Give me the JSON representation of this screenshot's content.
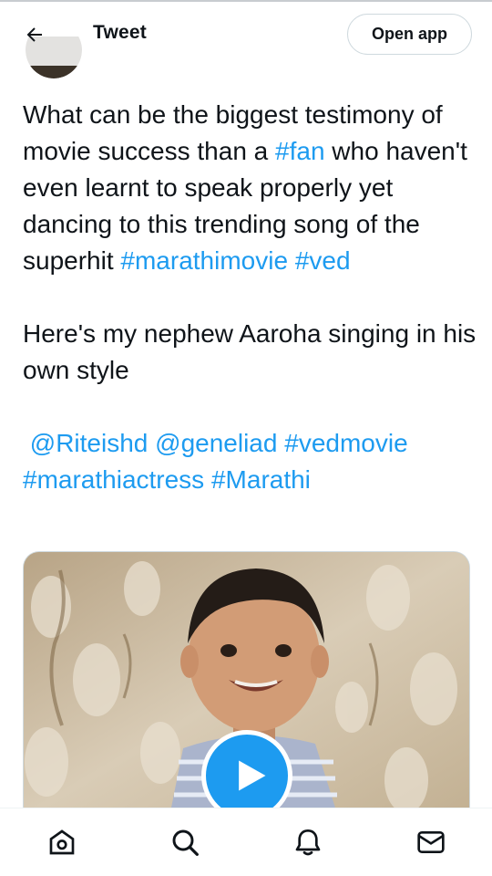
{
  "header": {
    "title": "Tweet",
    "open_app_label": "Open app",
    "back_icon": "arrow-left-icon"
  },
  "tweet": {
    "p1_seg1": "What can be the biggest testimony of movie success than a ",
    "p1_tag_fan": "#fan",
    "p1_seg2": " who haven't even learnt to speak properly yet dancing to this trending song of the superhit ",
    "p1_tag_marathimovie": "#marathimovie",
    "p1_space": " ",
    "p1_tag_ved": "#ved",
    "p2": "Here's my nephew Aaroha singing in his own style",
    "p3_tag1": "@Riteishd",
    "p3_tag2": "@geneliad",
    "p3_tag3": "#vedmovie",
    "p3_tag4": "#marathiactress",
    "p3_tag5": "#Marathi"
  },
  "media": {
    "type": "video",
    "play_icon": "play-icon"
  },
  "bottom_nav": {
    "items": [
      "home-icon",
      "search-icon",
      "notifications-bell-icon",
      "messages-mail-icon"
    ]
  },
  "colors": {
    "accent": "#1d9bf0",
    "text": "#0f1419",
    "border": "#cfd9de"
  }
}
